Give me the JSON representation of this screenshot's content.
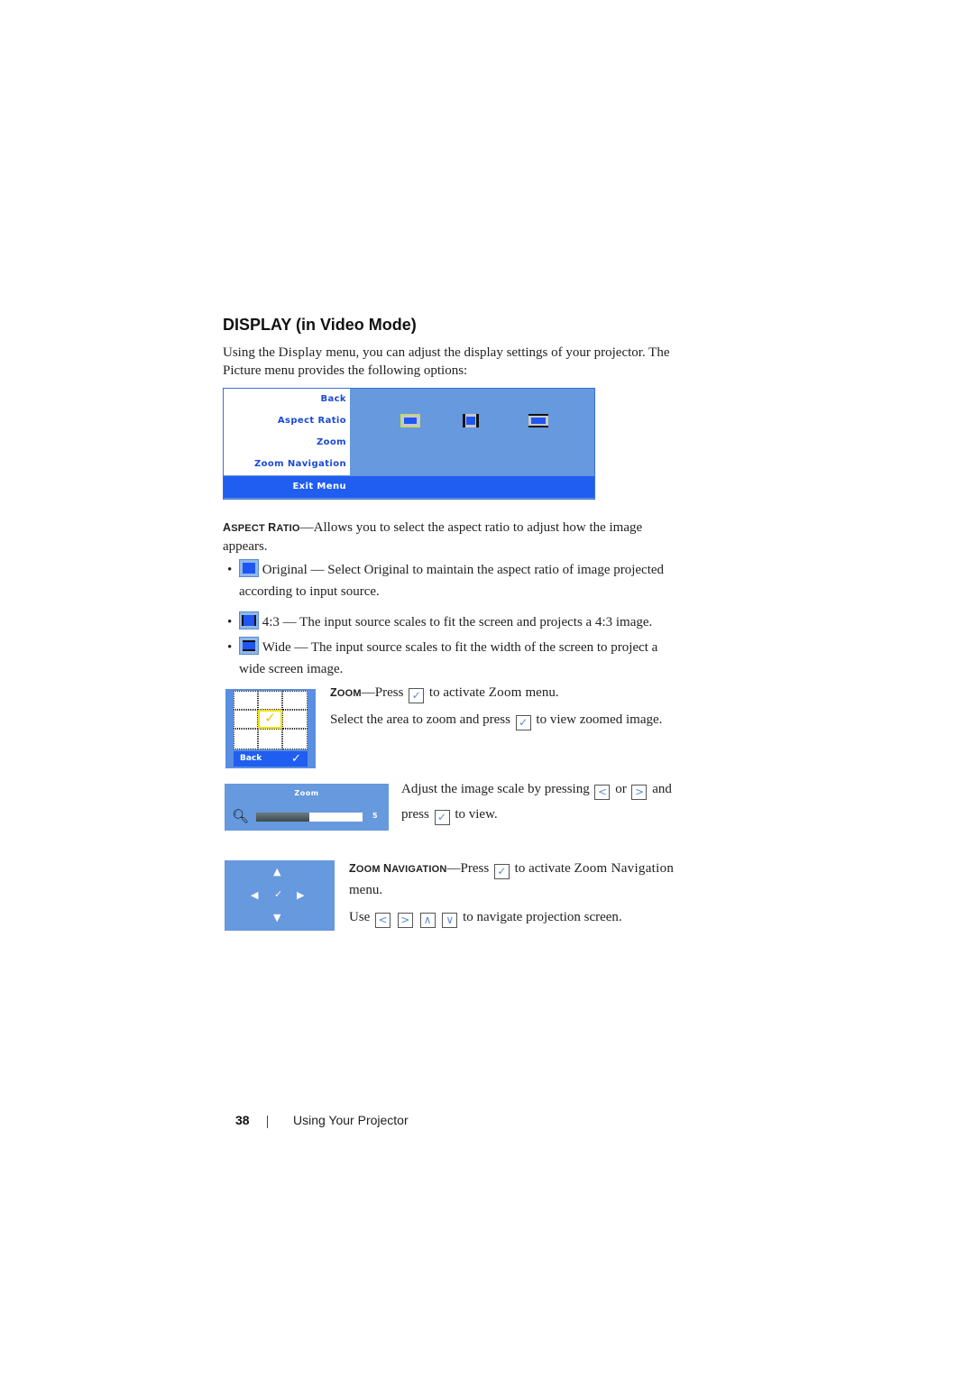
{
  "section_title": "DISPLAY (in Video Mode)",
  "intro": {
    "line1_pre": "Using the ",
    "line1_bold": "Display",
    "line1_post": " menu, you can adjust the display settings of your projector. The",
    "line2": "Picture menu provides the following options:"
  },
  "osd_menu": {
    "items": [
      {
        "label": "Back",
        "value": "check"
      },
      {
        "label": "Aspect Ratio",
        "value": "icons",
        "icons": [
          "original",
          "4:3",
          "wide"
        ],
        "selected": "original"
      },
      {
        "label": "Zoom",
        "value": "check"
      },
      {
        "label": "Zoom Navigation",
        "value": "check"
      }
    ],
    "exit_label": "Exit Menu",
    "check_glyph": "✓",
    "colors": {
      "panel": "#6699dd",
      "label_text": "#1b49d6",
      "exit_bar": "#1f5ef0"
    }
  },
  "aspect_ratio": {
    "term": "Aspect Ratio",
    "term_cap1": "A",
    "term_rest1": "SPECT ",
    "term_cap2": "R",
    "term_rest2": "ATIO",
    "desc_line1": "—Allows you to select the aspect ratio to adjust how the image",
    "desc_line2": "appears.",
    "bullets": [
      {
        "icon": "original-aspect-icon",
        "line1": "Original — Select Original to maintain the aspect ratio of image projected",
        "line2": "according to input source."
      },
      {
        "icon": "4-3-aspect-icon",
        "line1": "4:3 — The input source scales to fit the screen and projects a 4:3 image."
      },
      {
        "icon": "wide-aspect-icon",
        "line1": "Wide — The input source scales to fit the width of the screen to project a",
        "line2": "wide screen image."
      }
    ],
    "bullet_glyph": "•"
  },
  "zoom": {
    "term_cap": "Z",
    "term_rest": "OOM",
    "line1_pre": "—Press ",
    "line1_mid": " to activate ",
    "line1_bold": "Zoom",
    "line1_post": " menu.",
    "line2_pre": "Select the area to zoom and press ",
    "line2_post": " to view zoomed image.",
    "grid_back_label": "Back",
    "grid_selected_cell": "center",
    "scale_line1_pre": "Adjust the image scale by pressing ",
    "scale_or": " or ",
    "scale_and": " and",
    "scale_line2_pre": "press ",
    "scale_line2_post": " to view.",
    "slider": {
      "title": "Zoom",
      "value": 5,
      "fill_fraction": 0.5
    }
  },
  "zoom_navigation": {
    "term_cap1": "Z",
    "term_rest1": "OOM ",
    "term_cap2": "N",
    "term_rest2": "AVIGATION",
    "line1_pre": "—Press ",
    "line1_mid": " to activate ",
    "line1_bold": "Zoom Navigation",
    "line2": "menu.",
    "line3_pre": "Use ",
    "line3_post": " to navigate projection screen."
  },
  "keys": {
    "enter": "✓",
    "left": "<",
    "right": ">",
    "up": "∧",
    "down": "∨"
  },
  "footer": {
    "page_number": "38",
    "chapter": "Using Your Projector"
  }
}
